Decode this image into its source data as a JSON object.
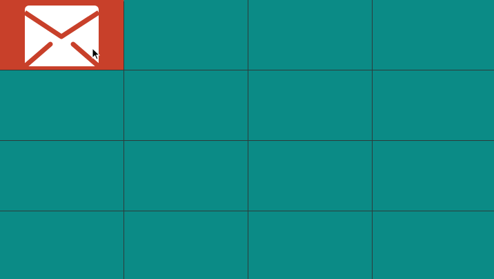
{
  "app": {
    "colors": {
      "tile": "#0b8b86",
      "grid_line": "#2d3b3a",
      "accent": "#c8402a",
      "icon_bg": "#ffffff"
    },
    "tiles": [
      {
        "icon": "mail-icon",
        "accent": true
      },
      {
        "icon": "",
        "accent": false
      },
      {
        "icon": "",
        "accent": false
      },
      {
        "icon": "",
        "accent": false
      },
      {
        "icon": "",
        "accent": false
      },
      {
        "icon": "",
        "accent": false
      },
      {
        "icon": "",
        "accent": false
      },
      {
        "icon": "",
        "accent": false
      },
      {
        "icon": "",
        "accent": false
      },
      {
        "icon": "",
        "accent": false
      },
      {
        "icon": "",
        "accent": false
      },
      {
        "icon": "",
        "accent": false
      },
      {
        "icon": "",
        "accent": false
      },
      {
        "icon": "",
        "accent": false
      },
      {
        "icon": "",
        "accent": false
      },
      {
        "icon": "",
        "accent": false
      }
    ],
    "cursor": "arrow-cursor"
  }
}
